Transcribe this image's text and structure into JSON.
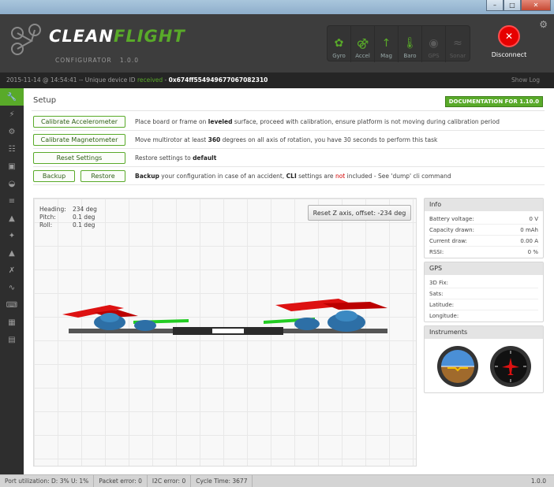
{
  "app": {
    "logo_text_1": "CLEAN",
    "logo_text_2": "FLIGHT",
    "sub_title": "CONFIGURATOR",
    "version": "1.0.0",
    "accent_color": "#59aa29"
  },
  "sensors": [
    {
      "label": "Gyro",
      "icon": "gyro-icon",
      "state": "on"
    },
    {
      "label": "Accel",
      "icon": "accel-icon",
      "state": "on"
    },
    {
      "label": "Mag",
      "icon": "mag-icon",
      "state": "on"
    },
    {
      "label": "Baro",
      "icon": "baro-icon",
      "state": "on"
    },
    {
      "label": "GPS",
      "icon": "gps-icon",
      "state": "off"
    },
    {
      "label": "Sonar",
      "icon": "sonar-icon",
      "state": "off"
    }
  ],
  "connect": {
    "label": "Disconnect"
  },
  "statusline": {
    "timestamp": "2015-11-14 @ 14:54:41",
    "text": "-- Unique device ID",
    "received": "received",
    "dash": "-",
    "device_id": "0x674ff554949677067082310",
    "show_log": "Show Log"
  },
  "setup": {
    "title": "Setup",
    "doc_button": "DOCUMENTATION FOR 1.10.0",
    "calibrate_acc": {
      "label": "Calibrate Accelerometer",
      "d1": "Place board or frame on ",
      "d2": "leveled",
      "d3": " surface, proceed with calibration, ensure platform is not moving during calibration period"
    },
    "calibrate_mag": {
      "label": "Calibrate Magnetometer",
      "d1": "Move multirotor at least ",
      "d2": "360",
      "d3": " degrees on all axis of rotation, you have 30 seconds to perform this task"
    },
    "reset": {
      "label": "Reset Settings",
      "d1": "Restore settings to ",
      "d2": "default"
    },
    "backup": {
      "backup_label": "Backup",
      "restore_label": "Restore",
      "d1": "Backup",
      "d2": " your configuration in case of an accident, ",
      "d3": "CLI",
      "d4": " settings are ",
      "d5": "not",
      "d6": " included - See 'dump' cli command"
    }
  },
  "attitude": {
    "heading_label": "Heading:",
    "heading": "234 deg",
    "pitch_label": "Pitch:",
    "pitch": "0.1 deg",
    "roll_label": "Roll:",
    "roll": "0.1 deg"
  },
  "reset_z": "Reset Z axis, offset: -234 deg",
  "info": {
    "title": "Info",
    "rows": [
      {
        "k": "Battery voltage:",
        "v": "0 V"
      },
      {
        "k": "Capacity drawn:",
        "v": "0 mAh"
      },
      {
        "k": "Current draw:",
        "v": "0.00 A"
      },
      {
        "k": "RSSI:",
        "v": "0 %"
      }
    ]
  },
  "gps": {
    "title": "GPS",
    "rows": [
      {
        "k": "3D Fix:",
        "v": ""
      },
      {
        "k": "Sats:",
        "v": ""
      },
      {
        "k": "Latitude:",
        "v": ""
      },
      {
        "k": "Longitude:",
        "v": ""
      }
    ]
  },
  "instruments": {
    "title": "Instruments"
  },
  "bottom": {
    "port": "Port utilization: D: 3% U: 1%",
    "packet": "Packet error: 0",
    "i2c": "I2C error: 0",
    "cycle": "Cycle Time: 3677",
    "version": "1.0.0"
  }
}
